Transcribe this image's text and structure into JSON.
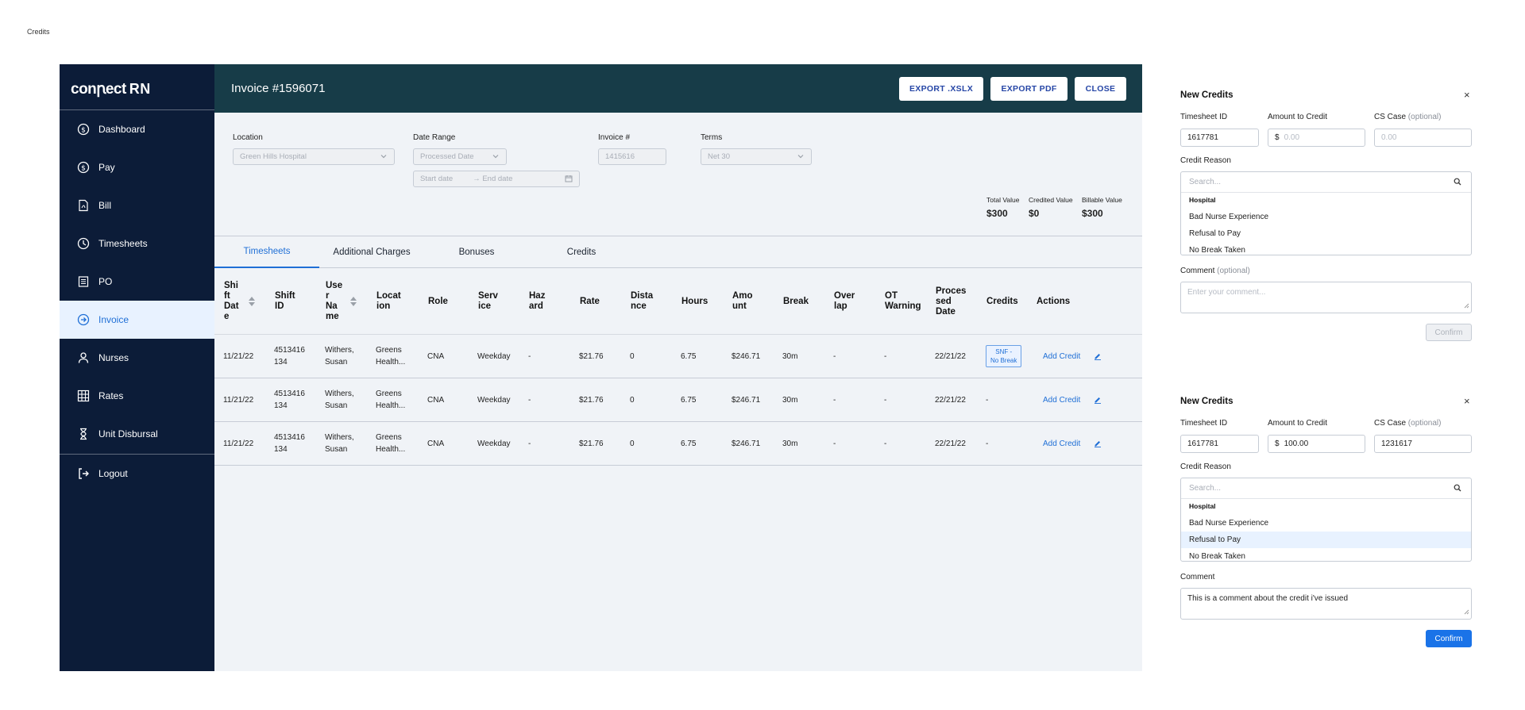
{
  "page_label": "Credits",
  "sidebar": {
    "logo_main": "conꞃect",
    "logo_rn": "RN",
    "items": [
      {
        "label": "Dashboard",
        "icon": "dollar-circle-icon"
      },
      {
        "label": "Pay",
        "icon": "dollar-circle-icon"
      },
      {
        "label": "Bill",
        "icon": "pdf-file-icon"
      },
      {
        "label": "Timesheets",
        "icon": "clock-icon"
      },
      {
        "label": "PO",
        "icon": "document-list-icon"
      },
      {
        "label": "Invoice",
        "icon": "arrow-circle-icon",
        "active": true
      },
      {
        "label": "Nurses",
        "icon": "person-icon"
      },
      {
        "label": "Rates",
        "icon": "grid-icon"
      },
      {
        "label": "Unit Disbursal",
        "icon": "hourglass-icon"
      }
    ],
    "logout": "Logout"
  },
  "header": {
    "title": "Invoice #1596071",
    "buttons": [
      "EXPORT .XSLX",
      "EXPORT PDF",
      "CLOSE"
    ]
  },
  "filters": {
    "location_label": "Location",
    "location_value": "Green Hills Hospital",
    "date_range_label": "Date Range",
    "date_range_value": "Processed Date",
    "start_date": "Start date",
    "end_date": "→ End date",
    "invoice_label": "Invoice #",
    "invoice_value": "1415616",
    "terms_label": "Terms",
    "terms_value": "Net 30"
  },
  "totals": [
    {
      "label": "Total Value",
      "value": "$300"
    },
    {
      "label": "Credited Value",
      "value": "$0"
    },
    {
      "label": "Billable Value",
      "value": "$300"
    }
  ],
  "tabs": [
    "Timesheets",
    "Additional Charges",
    "Bonuses",
    "Credits"
  ],
  "table": {
    "headers": [
      "Shi\nft\nDat\ne",
      "Shift\nID",
      "Use\nr\nNa\nme",
      "Locat\nion",
      "Role",
      "Serv\nice",
      "Haz\nard",
      "Rate",
      "Dista\nnce",
      "Hours",
      "Amo\nunt",
      "Break",
      "Over\nlap",
      "OT\nWarning",
      "Proces\nsed\nDate",
      "Credits",
      "Actions"
    ],
    "rows": [
      {
        "date": "11/21/22",
        "shift_id": "4513416\n134",
        "name": "Withers,\nSusan",
        "location": "Greens\nHealth...",
        "role": "CNA",
        "service": "Weekday",
        "hazard": "-",
        "rate": "$21.76",
        "distance": "0",
        "hours": "6.75",
        "amount": "$246.71",
        "break": "30m",
        "overlap": "-",
        "ot": "-",
        "processed": "22/21/22",
        "credits": "SNF -\nNo Break",
        "credits_badge": true,
        "action": "Add Credit"
      },
      {
        "date": "11/21/22",
        "shift_id": "4513416\n134",
        "name": "Withers,\nSusan",
        "location": "Greens\nHealth...",
        "role": "CNA",
        "service": "Weekday",
        "hazard": "-",
        "rate": "$21.76",
        "distance": "0",
        "hours": "6.75",
        "amount": "$246.71",
        "break": "30m",
        "overlap": "-",
        "ot": "-",
        "processed": "22/21/22",
        "credits": "-",
        "credits_badge": false,
        "action": "Add Credit"
      },
      {
        "date": "11/21/22",
        "shift_id": "4513416\n134",
        "name": "Withers,\nSusan",
        "location": "Greens\nHealth...",
        "role": "CNA",
        "service": "Weekday",
        "hazard": "-",
        "rate": "$21.76",
        "distance": "0",
        "hours": "6.75",
        "amount": "$246.71",
        "break": "30m",
        "overlap": "-",
        "ot": "-",
        "processed": "22/21/22",
        "credits": "-",
        "credits_badge": false,
        "action": "Add Credit"
      }
    ]
  },
  "panels": [
    {
      "title": "New Credits",
      "close": "×",
      "timesheet_label": "Timesheet ID",
      "timesheet_value": "1617781",
      "amount_label": "Amount to Credit",
      "amount_prefix": "$",
      "amount_value": "0.00",
      "amount_placeholder": true,
      "cs_label": "CS Case",
      "cs_optional": "(optional)",
      "cs_value": "0.00",
      "cs_placeholder": true,
      "reason_label": "Credit Reason",
      "search_placeholder": "Search...",
      "group": "Hospital",
      "options": [
        "Bad Nurse Experience",
        "Refusal to Pay",
        "No Break Taken"
      ],
      "selected": -1,
      "comment_label": "Comment",
      "comment_optional": "(optional)",
      "comment_value": "Enter your comment...",
      "comment_placeholder": true,
      "confirm": "Confirm",
      "confirm_enabled": false
    },
    {
      "title": "New Credits",
      "close": "×",
      "timesheet_label": "Timesheet ID",
      "timesheet_value": "1617781",
      "amount_label": "Amount to Credit",
      "amount_prefix": "$",
      "amount_value": "100.00",
      "amount_placeholder": false,
      "cs_label": "CS Case",
      "cs_optional": "(optional)",
      "cs_value": "1231617",
      "cs_placeholder": false,
      "reason_label": "Credit Reason",
      "search_placeholder": "Search...",
      "group": "Hospital",
      "options": [
        "Bad Nurse Experience",
        "Refusal to Pay",
        "No Break Taken"
      ],
      "selected": 1,
      "comment_label": "Comment",
      "comment_optional": "",
      "comment_value": "This is a comment about the credit i've issued",
      "comment_placeholder": false,
      "confirm": "Confirm",
      "confirm_enabled": true
    }
  ]
}
